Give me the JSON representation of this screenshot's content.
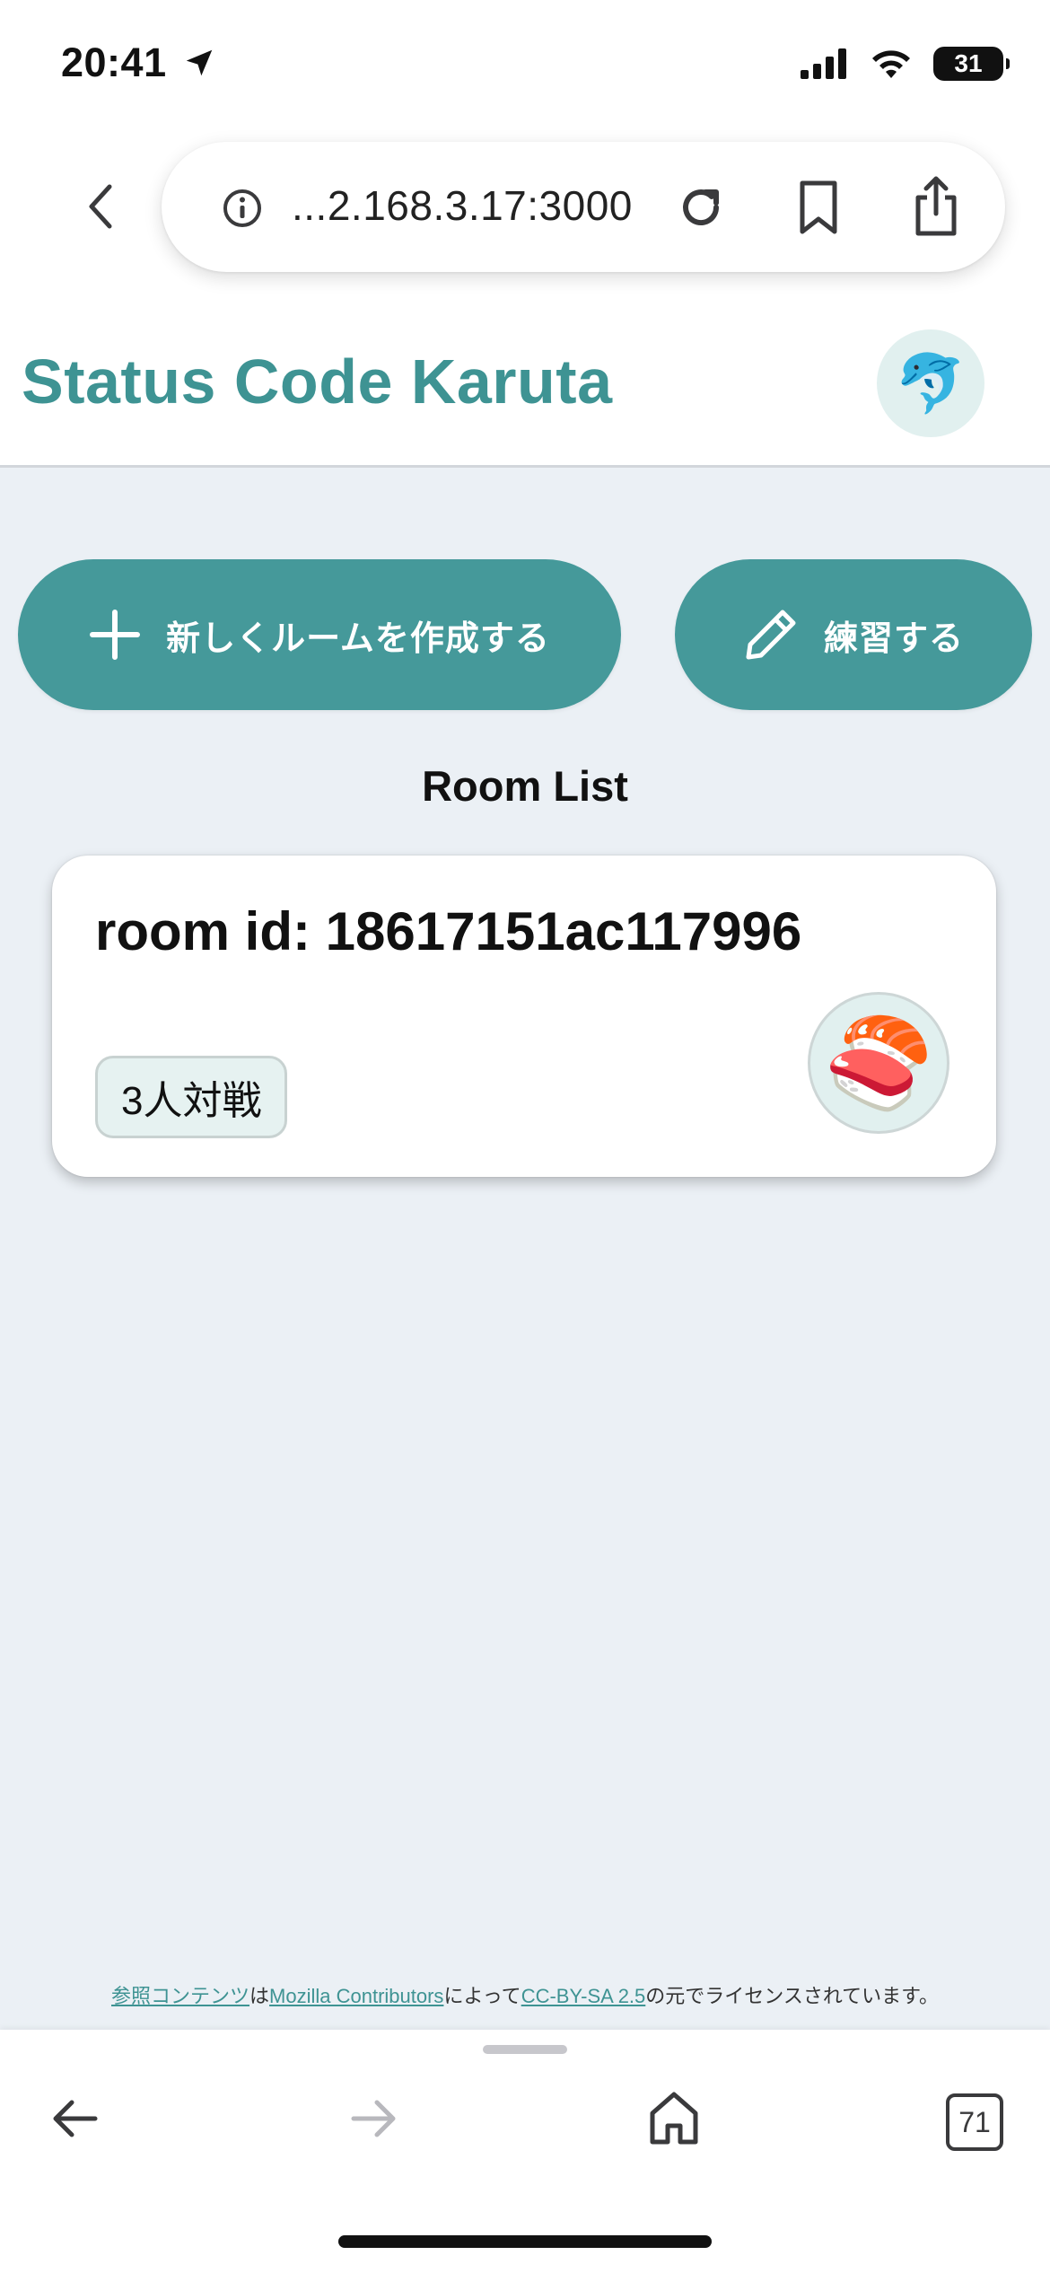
{
  "status_bar": {
    "time": "20:41",
    "battery": "31"
  },
  "browser": {
    "url": "...2.168.3.17:3000",
    "tab_count": "71"
  },
  "app": {
    "title": "Status Code Karuta",
    "avatar_emoji": "🐬"
  },
  "actions": {
    "create_room": "新しくルームを作成する",
    "practice": "練習する"
  },
  "room_list": {
    "title": "Room List",
    "rooms": [
      {
        "room_id_label": "room id: 18617151ac117996",
        "mode": "3人対戦",
        "avatar_emoji": "🍣"
      }
    ]
  },
  "footer": {
    "ref_link": "参照コンテンツ",
    "text1": "は",
    "contributors_link": "Mozilla Contributors",
    "text2": "によって",
    "license_link": "CC-BY-SA 2.5",
    "text3": "の元でライセンスされています。"
  },
  "colors": {
    "accent": "#45999a",
    "title": "#3e9393",
    "main_background": "#ebf0f5"
  }
}
